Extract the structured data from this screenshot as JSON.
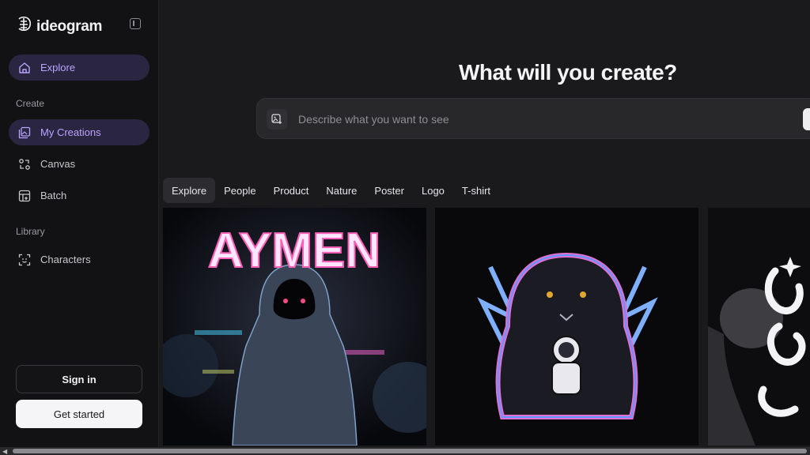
{
  "app": {
    "brand": "ideogram"
  },
  "sidebar": {
    "explore_label": "Explore",
    "create_section": "Create",
    "my_creations_label": "My Creations",
    "canvas_label": "Canvas",
    "batch_label": "Batch",
    "library_section": "Library",
    "characters_label": "Characters",
    "signin_label": "Sign in",
    "get_started_label": "Get started"
  },
  "main": {
    "headline": "What will you create?",
    "prompt_placeholder": "Describe what you want to see",
    "tabs": [
      "Explore",
      "People",
      "Product",
      "Nature",
      "Poster",
      "Logo",
      "T-shirt"
    ],
    "active_tab": "Explore"
  },
  "gallery": {
    "cards": [
      {
        "art_text": "AYMEN",
        "icon": "hooded-figure-art"
      },
      {
        "icon": "panther-astronaut-art"
      },
      {
        "icon": "calligraphy-portrait-art"
      }
    ]
  },
  "colors": {
    "accent": "#b9a4ff",
    "active_bg": "#2a2540",
    "background": "#1a1a1c",
    "sidebar": "#121214"
  }
}
